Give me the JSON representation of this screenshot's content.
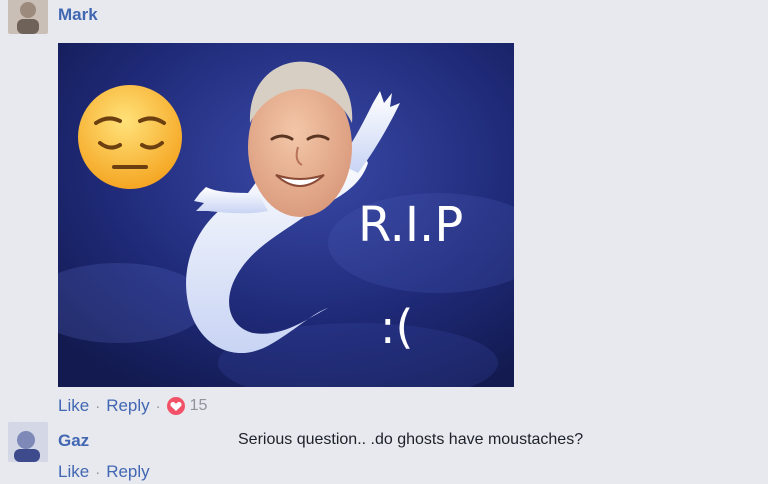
{
  "comments": [
    {
      "author": "Mark",
      "image": {
        "caption_line1": "R.I.P",
        "caption_line2": ":("
      },
      "actions": {
        "like": "Like",
        "reply": "Reply",
        "separator": "·",
        "reaction_count": "15"
      }
    },
    {
      "author": "Gaz",
      "text": "Serious question.. .do ghosts have moustaches?",
      "actions": {
        "like": "Like",
        "reply": "Reply",
        "separator": "·"
      }
    }
  ],
  "colors": {
    "link": "#4267b2",
    "background": "#e7e9ee",
    "heart": "#f25268",
    "photo_bg": "#1f2a6e"
  },
  "icons": [
    "pensive-face-emoji",
    "ghost-figure",
    "heart-reaction-icon"
  ]
}
